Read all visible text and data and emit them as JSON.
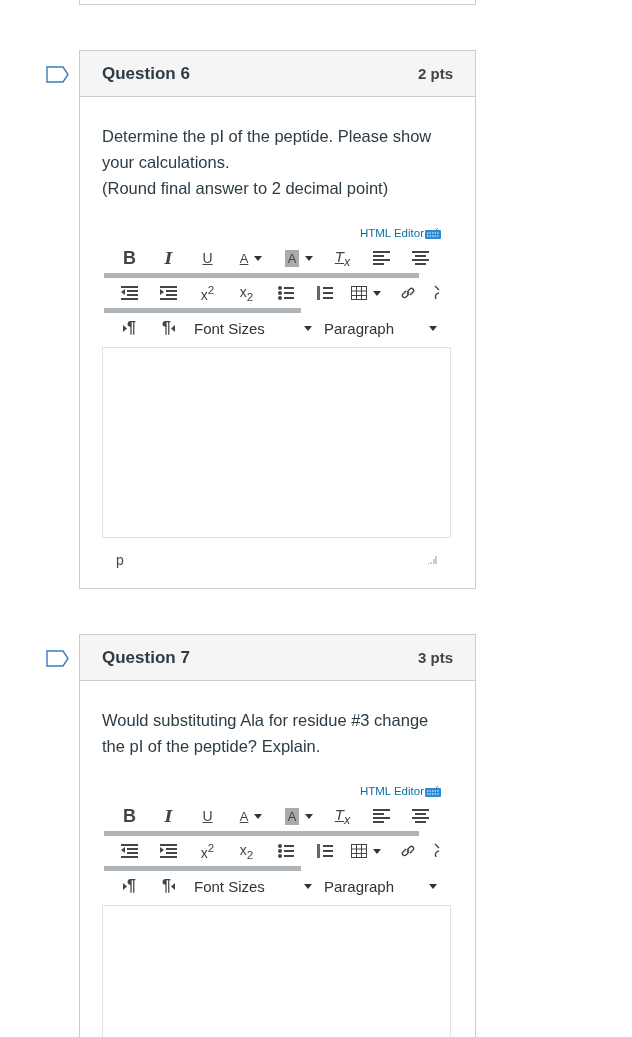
{
  "questions": [
    {
      "title": "Question 6",
      "points": "2 pts",
      "prompt": [
        "Determine the pI of the peptide. Please show your calculations.",
        "(Round final answer to 2 decimal point)"
      ],
      "editor_link": "HTML Editor",
      "toolbar_row_1": [
        {
          "kind": "bold",
          "label": "B"
        },
        {
          "kind": "italic",
          "label": "I"
        },
        {
          "kind": "underline",
          "label": "U"
        },
        {
          "kind": "color",
          "label": "A"
        },
        {
          "kind": "highlight",
          "label": "A"
        },
        {
          "kind": "clear",
          "label": "T$_{x}$"
        },
        {
          "kind": "align-left"
        },
        {
          "kind": "align-center"
        }
      ],
      "toolbar_row_2": [
        {
          "kind": "outdent"
        },
        {
          "kind": "indent"
        },
        {
          "kind": "sup",
          "label": "x$^{2}$"
        },
        {
          "kind": "sub",
          "label": "x$_{2}$"
        },
        {
          "kind": "bullets"
        },
        {
          "kind": "numbers"
        },
        {
          "kind": "table"
        },
        {
          "kind": "link"
        },
        {
          "kind": "more"
        }
      ],
      "toolbar_row_3": [
        {
          "kind": "ltr",
          "label": "¶"
        },
        {
          "kind": "rtl",
          "label": "¶"
        }
      ],
      "font_sizes": "Font Sizes",
      "paragraph": "Paragraph",
      "path": "p"
    },
    {
      "title": "Question 7",
      "points": "3 pts",
      "prompt": [
        "Would substituting Ala for residue #3 change the pI of the peptide? Explain."
      ],
      "editor_link": "HTML Editor",
      "toolbar_row_1": [
        {
          "kind": "bold",
          "label": "B"
        },
        {
          "kind": "italic",
          "label": "I"
        },
        {
          "kind": "underline",
          "label": "U"
        },
        {
          "kind": "color",
          "label": "A"
        },
        {
          "kind": "highlight",
          "label": "A"
        },
        {
          "kind": "clear",
          "label": "T$_{x}$"
        },
        {
          "kind": "align-left"
        },
        {
          "kind": "align-center"
        }
      ],
      "toolbar_row_2": [
        {
          "kind": "outdent"
        },
        {
          "kind": "indent"
        },
        {
          "kind": "sup",
          "label": "x$^{2}$"
        },
        {
          "kind": "sub",
          "label": "x$_{2}$"
        },
        {
          "kind": "bullets"
        },
        {
          "kind": "numbers"
        },
        {
          "kind": "table"
        },
        {
          "kind": "link"
        },
        {
          "kind": "more"
        }
      ],
      "toolbar_row_3": [
        {
          "kind": "ltr",
          "label": "¶"
        },
        {
          "kind": "rtl",
          "label": "¶"
        }
      ],
      "font_sizes": "Font Sizes",
      "paragraph": "Paragraph"
    }
  ]
}
